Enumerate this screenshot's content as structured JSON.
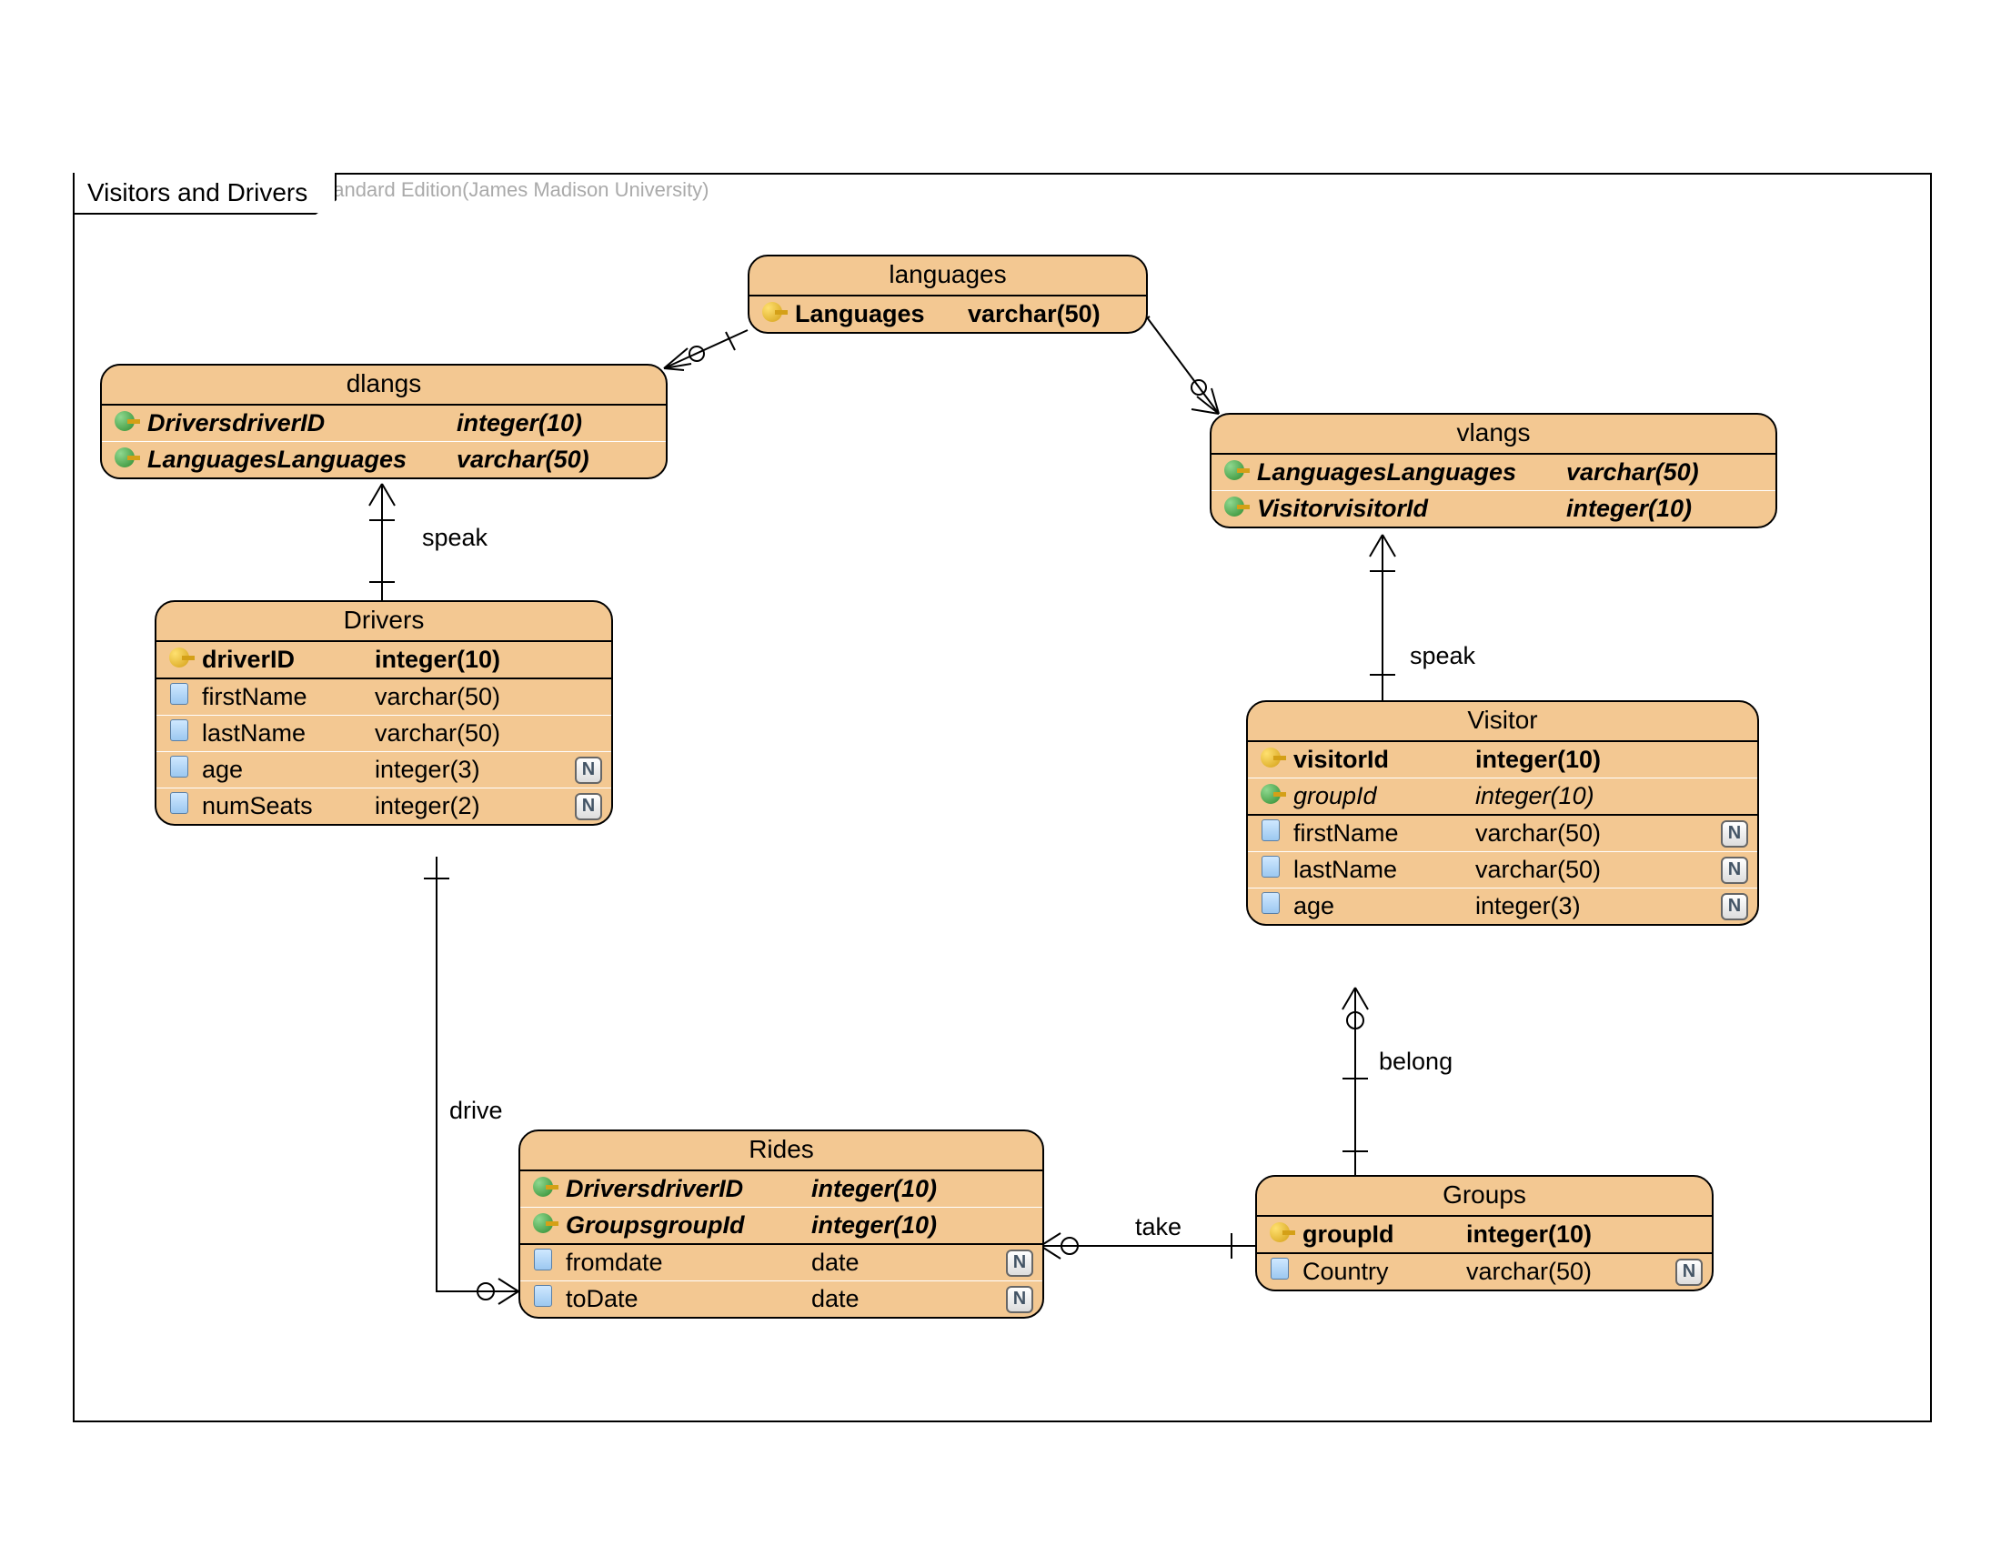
{
  "diagram": {
    "title": "Visitors and Drivers",
    "watermark": "Visual Paradigm for UML Standard Edition(James Madison University)"
  },
  "relations": {
    "speak1": "speak",
    "speak2": "speak",
    "drive": "drive",
    "take": "take",
    "belong": "belong"
  },
  "entities": {
    "languages": {
      "title": "languages",
      "cols": [
        {
          "icon": "pk",
          "name": "Languages",
          "type": "varchar(50)",
          "bold": true
        }
      ]
    },
    "dlangs": {
      "title": "dlangs",
      "cols": [
        {
          "icon": "fk",
          "name": "DriversdriverID",
          "type": "integer(10)",
          "bold": true,
          "italic": true
        },
        {
          "icon": "fk",
          "name": "LanguagesLanguages",
          "type": "varchar(50)",
          "bold": true,
          "italic": true
        }
      ]
    },
    "vlangs": {
      "title": "vlangs",
      "cols": [
        {
          "icon": "fk",
          "name": "LanguagesLanguages",
          "type": "varchar(50)",
          "bold": true,
          "italic": true
        },
        {
          "icon": "fk",
          "name": "VisitorvisitorId",
          "type": "integer(10)",
          "bold": true,
          "italic": true
        }
      ]
    },
    "drivers": {
      "title": "Drivers",
      "cols": [
        {
          "icon": "pk",
          "name": "driverID",
          "type": "integer(10)",
          "bold": true
        },
        {
          "icon": "col",
          "name": "firstName",
          "type": "varchar(50)"
        },
        {
          "icon": "col",
          "name": "lastName",
          "type": "varchar(50)"
        },
        {
          "icon": "col",
          "name": "age",
          "type": "integer(3)",
          "nn": true
        },
        {
          "icon": "col",
          "name": "numSeats",
          "type": "integer(2)",
          "nn": true
        }
      ]
    },
    "visitor": {
      "title": "Visitor",
      "cols": [
        {
          "icon": "pk",
          "name": "visitorId",
          "type": "integer(10)",
          "bold": true
        },
        {
          "icon": "fk",
          "name": "groupId",
          "type": "integer(10)",
          "italic": true
        },
        {
          "icon": "col",
          "name": "firstName",
          "type": "varchar(50)",
          "nn": true
        },
        {
          "icon": "col",
          "name": "lastName",
          "type": "varchar(50)",
          "nn": true
        },
        {
          "icon": "col",
          "name": "age",
          "type": "integer(3)",
          "nn": true
        }
      ]
    },
    "rides": {
      "title": "Rides",
      "cols": [
        {
          "icon": "fk",
          "name": "DriversdriverID",
          "type": "integer(10)",
          "bold": true,
          "italic": true
        },
        {
          "icon": "fk",
          "name": "GroupsgroupId",
          "type": "integer(10)",
          "bold": true,
          "italic": true
        },
        {
          "icon": "col",
          "name": "fromdate",
          "type": "date",
          "nn": true
        },
        {
          "icon": "col",
          "name": "toDate",
          "type": "date",
          "nn": true
        }
      ]
    },
    "groups": {
      "title": "Groups",
      "cols": [
        {
          "icon": "pk",
          "name": "groupId",
          "type": "integer(10)",
          "bold": true
        },
        {
          "icon": "col",
          "name": "Country",
          "type": "varchar(50)",
          "nn": true
        }
      ]
    }
  },
  "nn_glyph": "N"
}
